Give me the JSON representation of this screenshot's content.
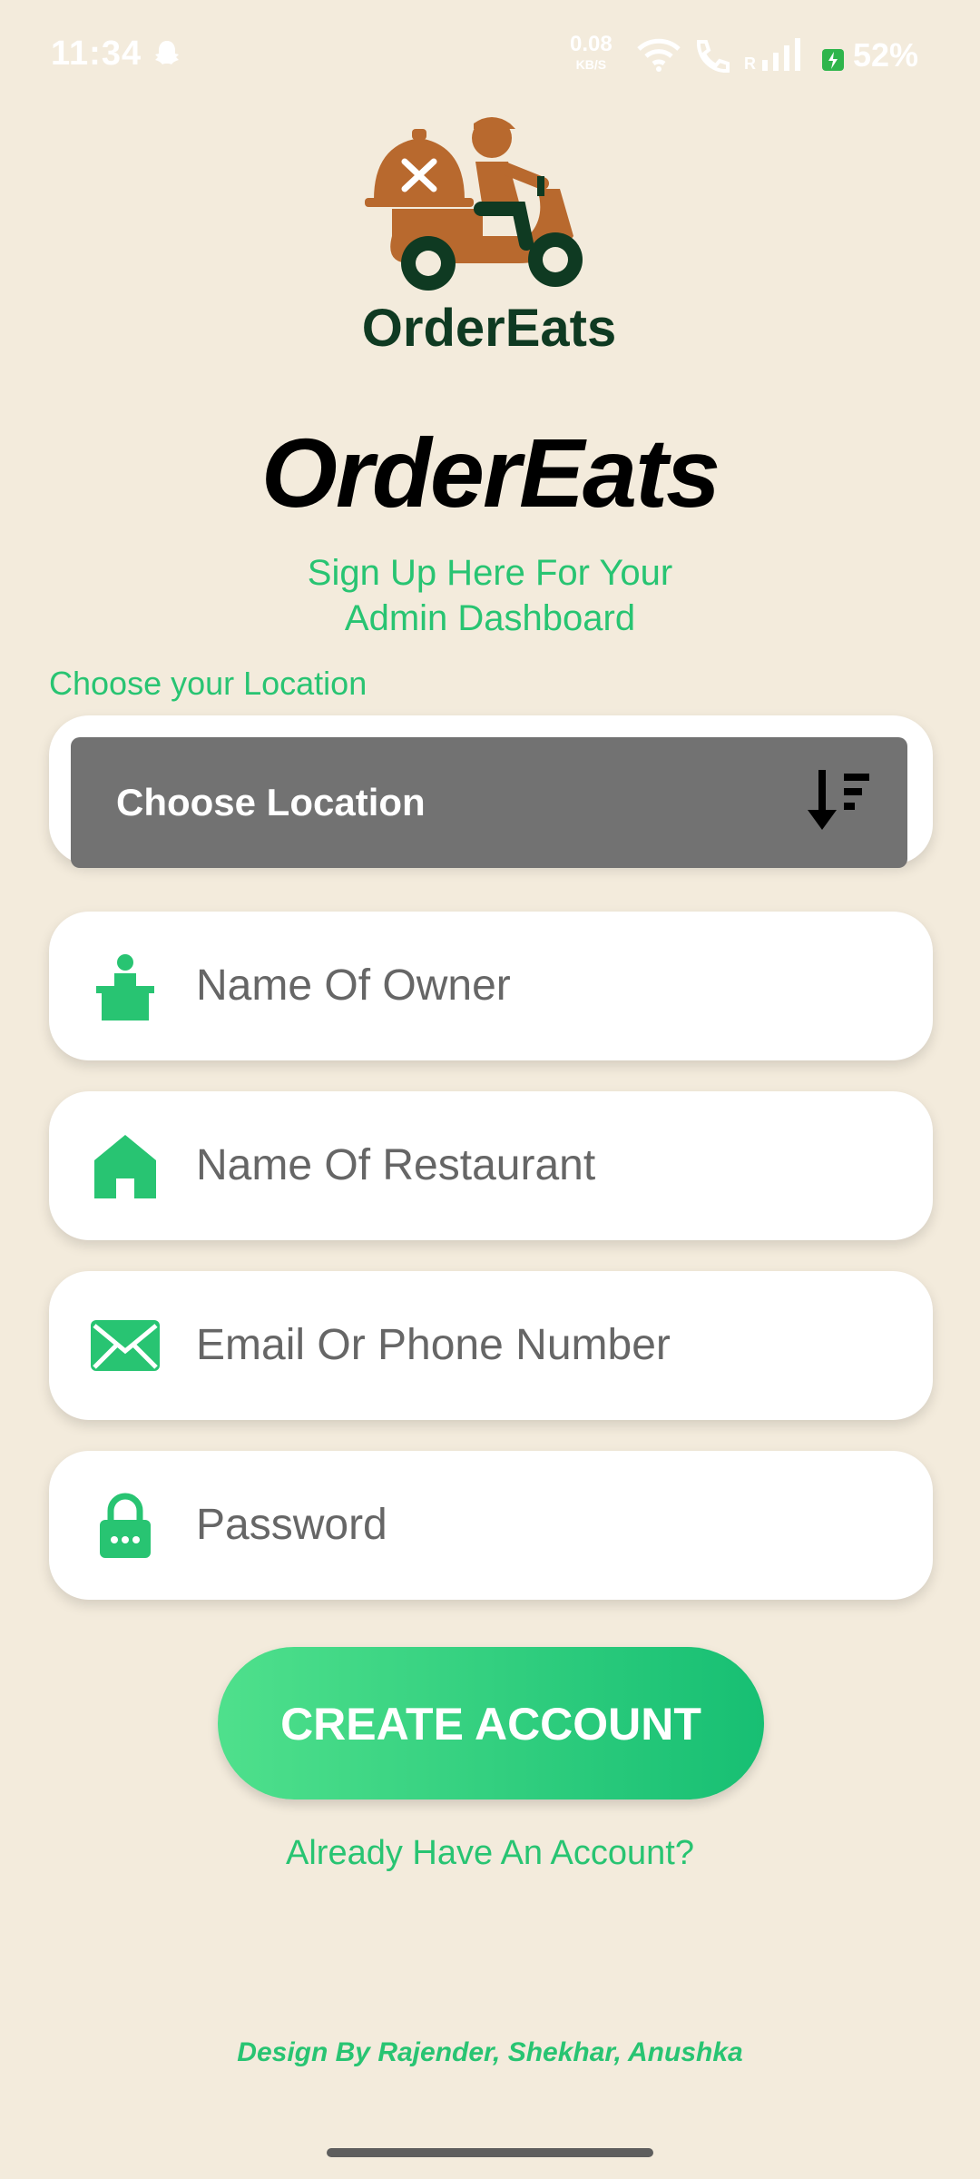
{
  "status_bar": {
    "time": "11:34",
    "net_speed": "0.08",
    "net_unit": "KB/S",
    "battery": "52%"
  },
  "logo": {
    "text": "OrderEats"
  },
  "title": "OrderEats",
  "subtitle": "Sign Up Here For Your Admin Dashboard",
  "location_label": "Choose your Location",
  "location_select": {
    "value": "Choose Location"
  },
  "fields": {
    "owner": "Name Of Owner",
    "restaurant": "Name Of Restaurant",
    "email": "Email Or Phone Number",
    "password": "Password"
  },
  "create_button": "CREATE ACCOUNT",
  "login_link": "Already Have An Account?",
  "footer": "Design By Rajender, Shekhar, Anushka",
  "colors": {
    "background": "#f3ebdc",
    "accent": "#28c472",
    "select_bg": "#727272",
    "logo_brown": "#b8692e",
    "logo_green": "#0f3a22"
  }
}
